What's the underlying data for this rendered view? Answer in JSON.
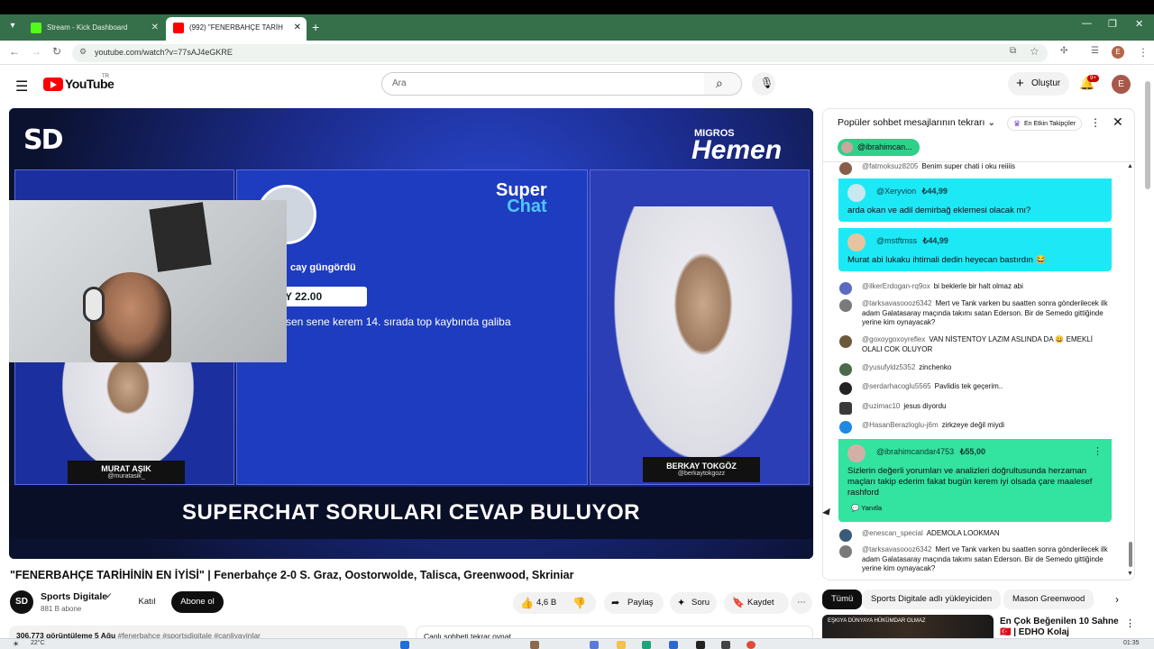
{
  "browser": {
    "tabs": [
      {
        "label": "Stream - Kick Dashboard",
        "favicon_color": "#53fc18"
      },
      {
        "label": "(992) \"FENERBAHÇE TARİH",
        "favicon_color": "#ff0000"
      }
    ],
    "new_tab": "+",
    "url": "youtube.com/watch?v=77sAJ4eGKRE",
    "profile_initial": "E"
  },
  "masthead": {
    "logo_text": "YouTube",
    "country": "TR",
    "search_placeholder": "Ara",
    "create_label": "Oluştur",
    "notification_count": "9+",
    "avatar_initial": "E"
  },
  "video": {
    "channel_logo": "SD",
    "sponsor_top": "MIGROS",
    "sponsor_main": "Hemen",
    "superchat_title_1": "Super",
    "superchat_title_2": "Chat",
    "superchat_name": "cay güngördü",
    "superchat_amount": "Y 22.00",
    "superchat_message": "sen sene kerem 14. sırada top kaybında galiba",
    "left_person_name": "MURAT AŞIK",
    "left_person_handle": "@muratasik_",
    "right_person_name": "BERKAY TOKGÖZ",
    "right_person_handle": "@berkaytokgozz",
    "banner": "SUPERCHAT SORULARI CEVAP BULUYOR"
  },
  "under_video": {
    "title": "\"FENERBAHÇE TARİHİNİN EN İYİSİ\" | Fenerbahçe 2-0 S. Graz, Oostorwolde, Talisca, Greenwood, Skriniar",
    "channel_name": "Sports Digitale",
    "channel_avatar": "SD",
    "subscribers": "881 B abone",
    "join_label": "Katıl",
    "subscribe_label": "Abone ol",
    "like_count": "4,6 B",
    "share_label": "Paylaş",
    "ask_label": "Soru",
    "save_label": "Kaydet",
    "description_preview": "306.773 görüntüleme  5 Ağu",
    "description_tags": "#fenerbahçe #sportsdigitale #canliyayinlar",
    "chat_replay_label": "Canlı sohbeti tekrar oynat"
  },
  "chat": {
    "header": "Popüler sohbet mesajlarının tekrarı",
    "filter_tag": "En Etkin Takipçiler",
    "pinned_user": "@ibrahimcan...",
    "messages": [
      {
        "user": "@fatmoksuz8205",
        "text": "Benim super chati i oku reiiiis",
        "color": "#8a5c4a"
      },
      {
        "user": "@ilkerErdogan-rq9ox",
        "text": "bi beklerle bir halt olmaz abi",
        "color": "#5c6bc0"
      },
      {
        "user": "@tarksavasoooz6342",
        "text": "Mert ve Tank varken bu saatten sonra gönderilecek ilk adam Galatasaray maçında takımı satan Ederson. Bir de Semedo gittiğinde yerine kim oynayacak?",
        "color": "#7a7a7a"
      },
      {
        "user": "@goxoygoxoyreflex",
        "text": "VAN NİSTENTOY LAZIM ASLINDA DA 😀 EMEKLİ OLALI COK OLUYOR",
        "color": "#6b5a3a"
      },
      {
        "user": "@yusufyldz5352",
        "text": "zinchenko",
        "color": "#4a6a4a"
      },
      {
        "user": "@serdarhacoglu5565",
        "text": "Pavlidis tek geçerim..",
        "color": "#222222"
      },
      {
        "user": "@uzimac10",
        "text": "jesus diyordu",
        "color": "#3a3a3a"
      },
      {
        "user": "@HasanBerazloglu-j6m",
        "text": "zirkzeye değil miydi",
        "color": "#1e88e5"
      },
      {
        "user": "@enescan_special",
        "text": "ADEMOLA LOOKMAN",
        "color": "#3a5a7a"
      },
      {
        "user": "@tarksavasoooz6342",
        "text": "Mert ve Tank varken bu saatten sonra gönderilecek ilk adam Galatasaray maçında takımı satan Ederson. Bir de Semedo gittiğinde yerine kim oynayacak?",
        "color": "#7a7a7a"
      }
    ],
    "superchats": [
      {
        "user": "@Xeryvion",
        "amount": "₺44,99",
        "text": "arda okan ve adil demirbağ eklemesi olacak mı?"
      },
      {
        "user": "@mstftmss",
        "amount": "₺44,99",
        "text": "Murat abi lukaku ihtimali dedin heyecan bastırdın 😂"
      },
      {
        "user": "@ibrahimcandar4753",
        "amount": "₺55,00",
        "text": "Sizlerin değerli yorumları ve analizleri doğrultusunda herzaman maçları takip ederim fakat bugün kerem iyi olsada çare maalesef rashford",
        "reply": "Yanıtla"
      }
    ]
  },
  "recommendations": {
    "chips": [
      "Tümü",
      "Sports Digitale adlı yükleyiciden",
      "Mason Greenwood"
    ],
    "first_title": "En Çok Beğenilen 10 Sahne 🇹🇷 | EDHO Kolaj",
    "first_thumb_text": "EŞKIYA DÜNYAYA HÜKÜMDAR OLMAZ"
  },
  "taskbar": {
    "weather": "22°C",
    "clock": "01:35"
  }
}
